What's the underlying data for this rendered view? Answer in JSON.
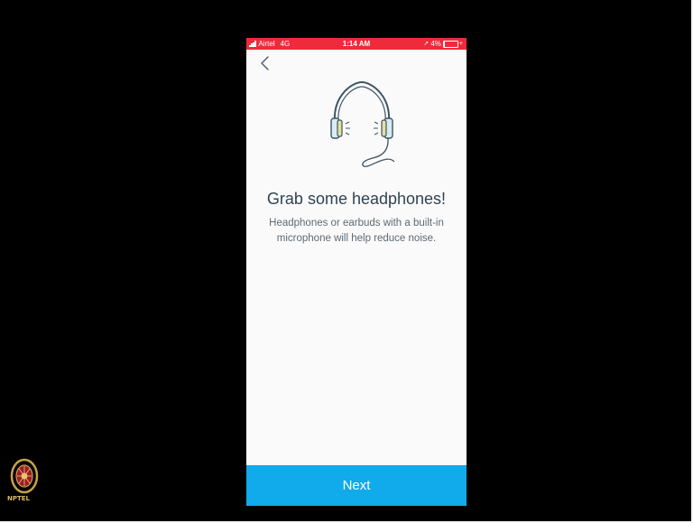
{
  "status_bar": {
    "carrier": "Airtel",
    "network": "4G",
    "time": "1:14 AM",
    "battery_percent": "4%",
    "battery_level": 0.04,
    "background_color": "#ee2a3b"
  },
  "navigation": {
    "back_icon": "chevron-left-icon"
  },
  "content": {
    "illustration_icon": "headphones-icon",
    "headline": "Grab some headphones!",
    "description": "Headphones or earbuds with a built-in microphone will help reduce noise."
  },
  "footer": {
    "next_label": "Next",
    "button_color": "#11aaea"
  },
  "watermark": {
    "logo_text": "NPTEL"
  }
}
